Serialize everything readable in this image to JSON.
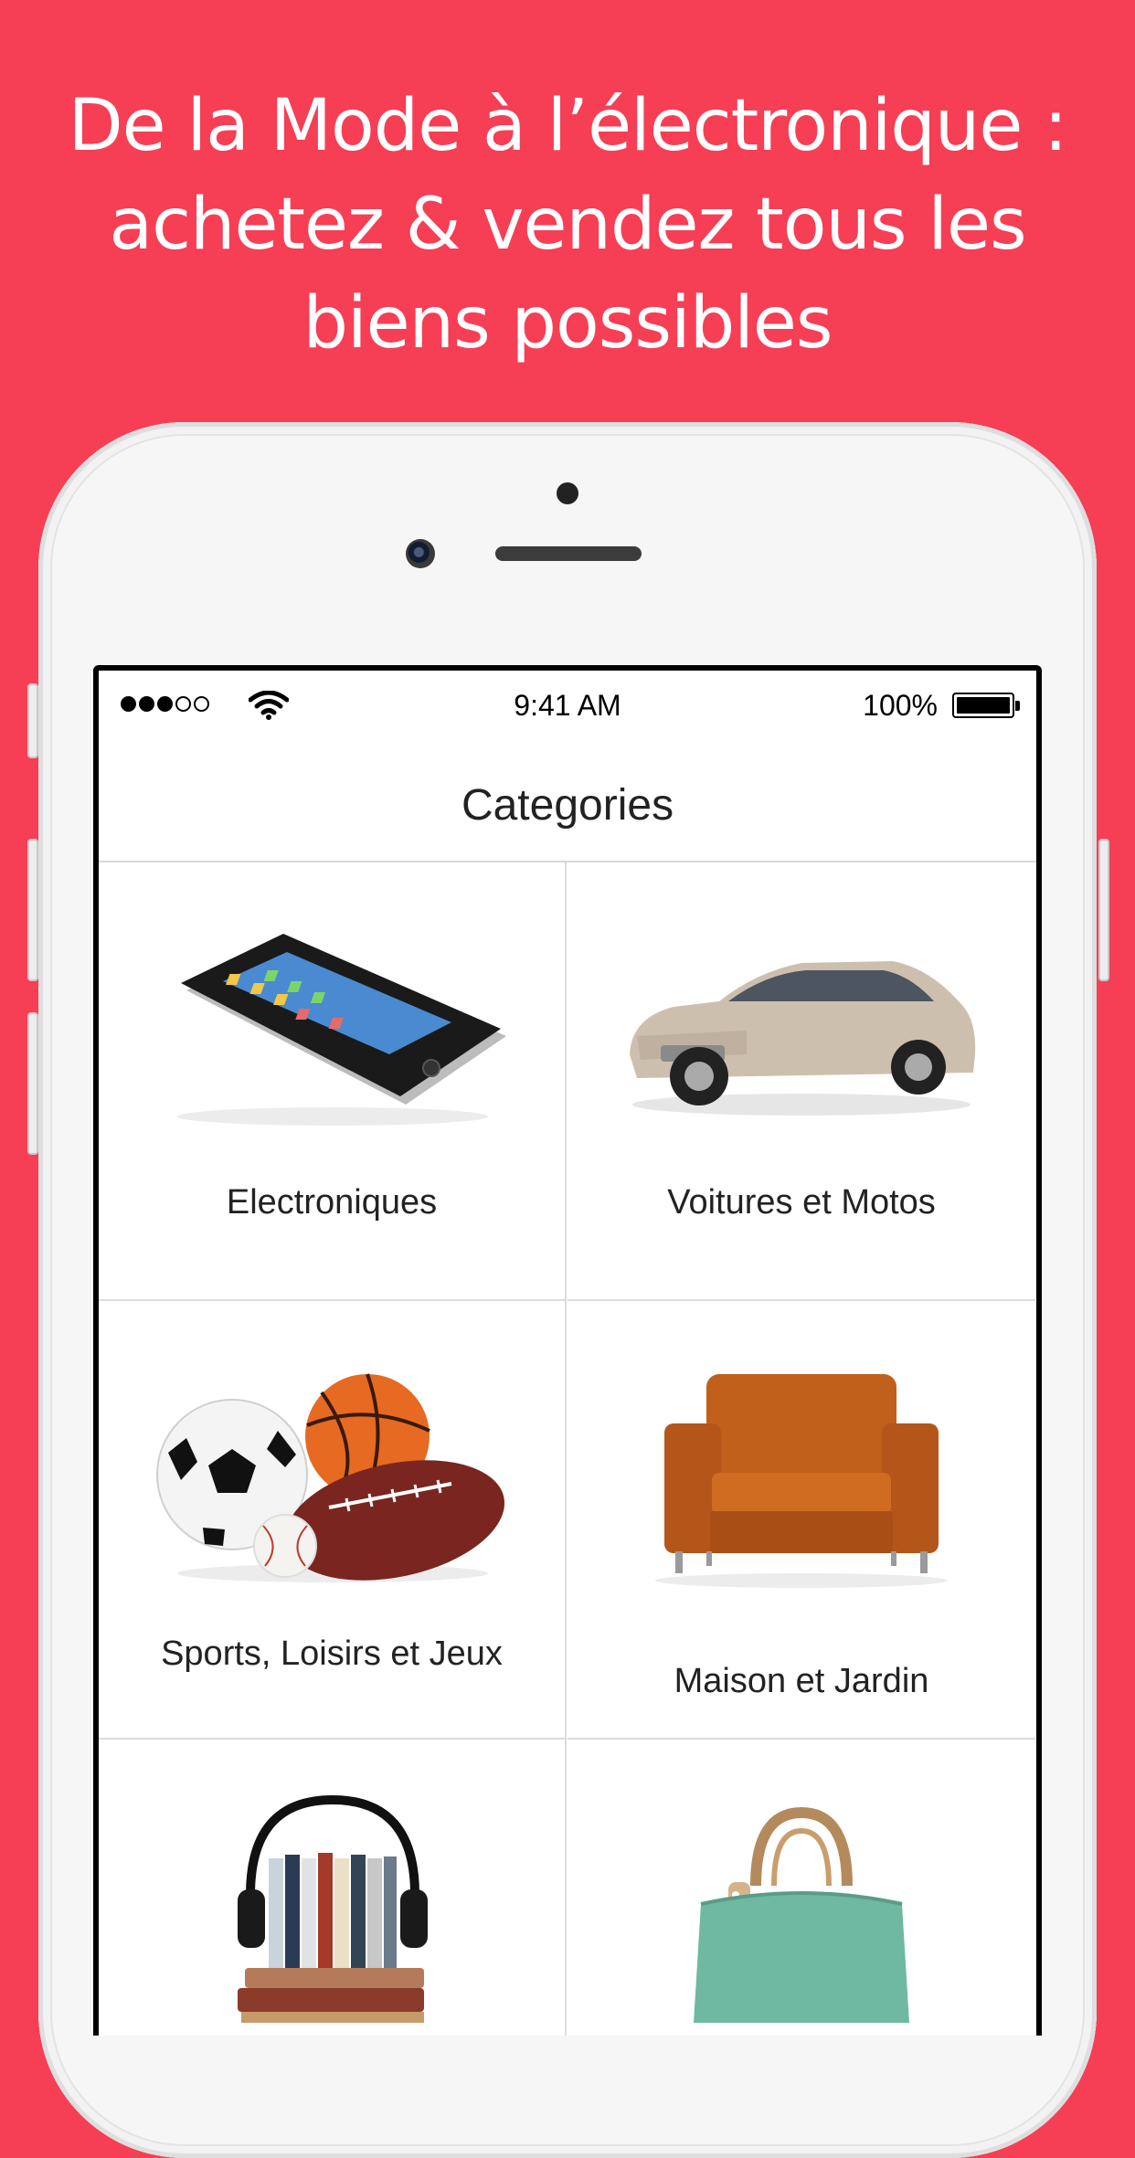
{
  "promo": {
    "headline_lines": [
      "De la Mode à l’électronique :",
      "achetez & vendez tous les",
      "biens possibles"
    ]
  },
  "colors": {
    "background": "#f63e55",
    "phone_body": "#f6f6f6",
    "screen_bg": "#ffffff"
  },
  "status_bar": {
    "time": "9:41 AM",
    "battery": "100%",
    "signal_bars": 3,
    "signal_total": 5
  },
  "nav": {
    "title": "Categories"
  },
  "categories": [
    {
      "label": "Electroniques",
      "icon": "smartphone-icon"
    },
    {
      "label": "Voitures et Motos",
      "icon": "car-icon"
    },
    {
      "label": "Sports, Loisirs et Jeux",
      "icon": "sports-balls-icon"
    },
    {
      "label": "Maison et Jardin",
      "icon": "armchair-icon"
    },
    {
      "label": "",
      "icon": "music-cds-icon"
    },
    {
      "label": "",
      "icon": "handbag-icon"
    }
  ]
}
